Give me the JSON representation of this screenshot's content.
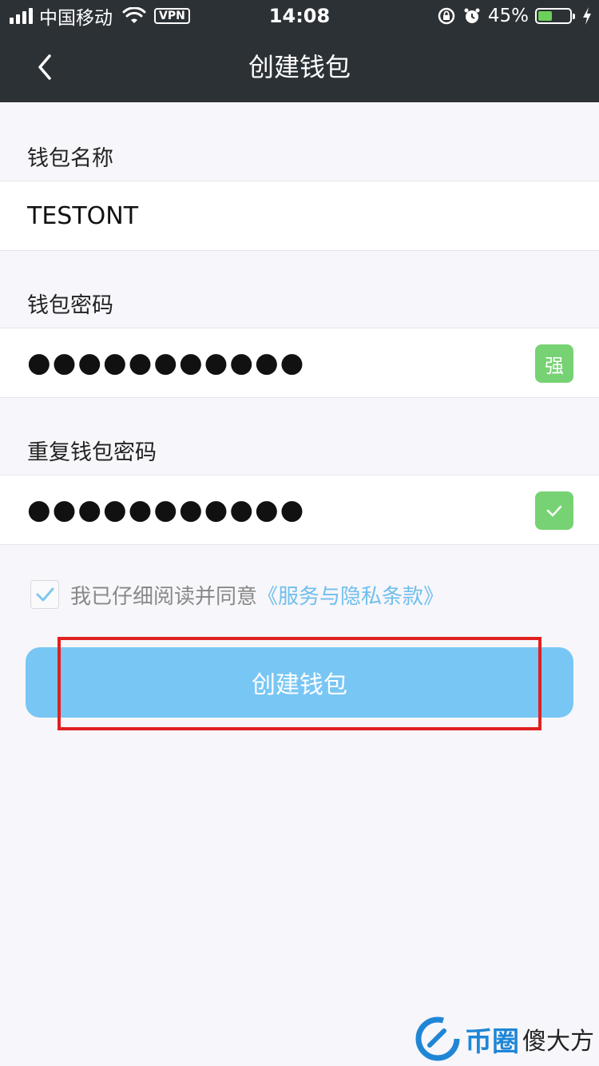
{
  "status_bar": {
    "carrier": "中国移动",
    "vpn": "VPN",
    "time": "14:08",
    "battery_percent": "45%",
    "battery_level": 0.45
  },
  "nav": {
    "title": "创建钱包"
  },
  "form": {
    "name_label": "钱包名称",
    "name_value": "TESTONT",
    "password_label": "钱包密码",
    "password_value": "●●●●●●●●●●●",
    "strength_badge": "强",
    "repeat_label": "重复钱包密码",
    "repeat_value": "●●●●●●●●●●●",
    "agree_checked": true,
    "agree_text": "我已仔细阅读并同意",
    "terms_link": "《服务与隐私条款》"
  },
  "actions": {
    "create_label": "创建钱包"
  },
  "colors": {
    "header_bg": "#2c3135",
    "accent_blue": "#78c6f4",
    "success_green": "#77d273",
    "highlight_red": "#e02020"
  },
  "watermark": {
    "text1": "币圈",
    "text2": "傻大方"
  }
}
